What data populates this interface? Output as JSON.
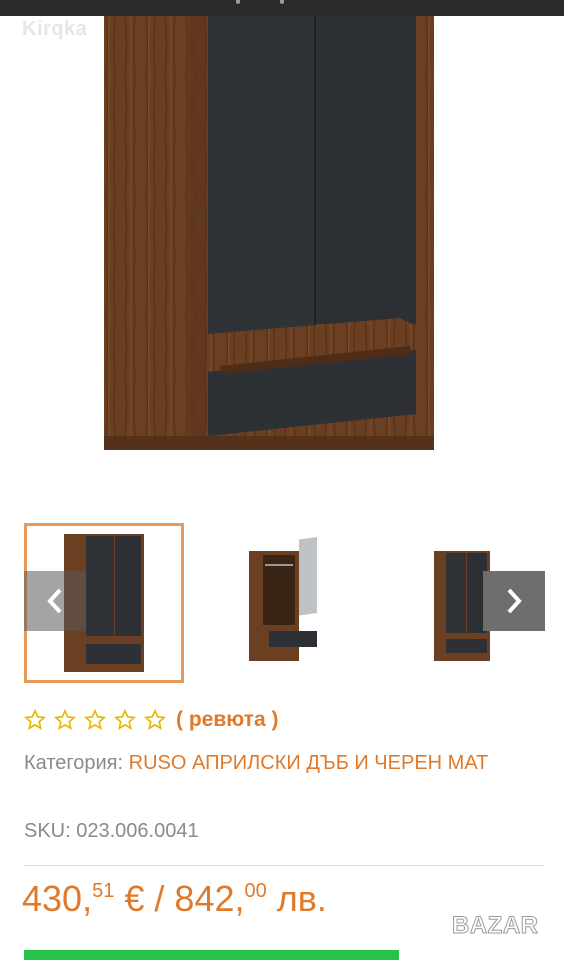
{
  "watermark_top": "Kirqka",
  "rating": {
    "stars": 0,
    "max": 5,
    "reviews_label": "( ревюта )"
  },
  "category": {
    "label": "Категория:",
    "value": "RUSO АПРИЛСКИ ДЪБ И ЧЕРЕН МАТ"
  },
  "sku": {
    "label": "SKU:",
    "value": "023.006.0041"
  },
  "price": {
    "eur_main": "430,",
    "eur_cents": "51",
    "eur_symbol": "€",
    "sep": "/",
    "bgn_main": "842,",
    "bgn_cents": "00",
    "bgn_symbol": "лв."
  },
  "bazar_watermark": "BAZAR",
  "colors": {
    "accent": "#e07a2a",
    "wood": "#6b3f22",
    "panel": "#2f3236",
    "cart": "#27c24a"
  },
  "icons": {
    "prev": "chevron-left-icon",
    "next": "chevron-right-icon",
    "star": "star-outline-icon"
  }
}
